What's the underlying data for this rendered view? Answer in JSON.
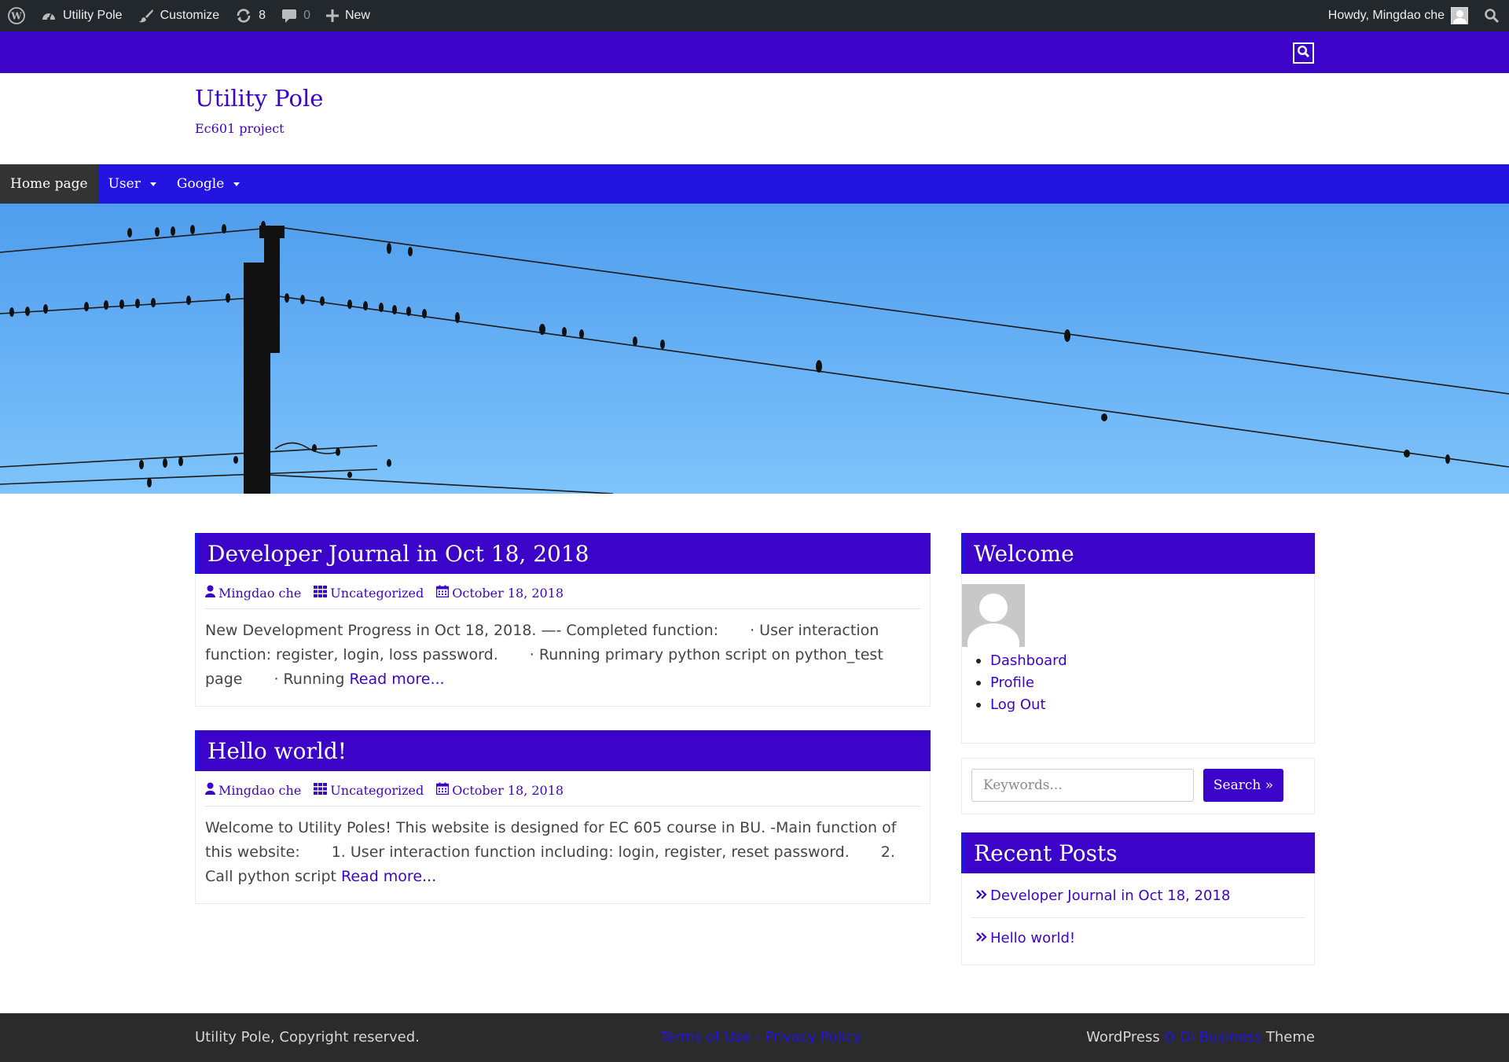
{
  "adminbar": {
    "wp_logo": "wordpress-logo-icon",
    "site_name": "Utility Pole",
    "customize": "Customize",
    "updates_count": "8",
    "comments_count": "0",
    "new_label": "New",
    "howdy": "Howdy, Mingdao che"
  },
  "header": {
    "title": "Utility Pole",
    "description": "Ec601 project"
  },
  "nav": {
    "items": [
      {
        "label": "Home page"
      },
      {
        "label": "User"
      },
      {
        "label": "Google"
      }
    ]
  },
  "posts": [
    {
      "title": "Developer Journal in Oct 18, 2018",
      "author": "Mingdao che",
      "category": "Uncategorized",
      "date": "October 18, 2018",
      "excerpt_l1a": "New Development Progress in Oct 18, 2018. —- Completed function:",
      "excerpt_l1b": "· User interaction",
      "excerpt_l2a": "function: register, login, loss password.",
      "excerpt_l2b": "· Running primary python script on python_test",
      "excerpt_l3a": "page",
      "excerpt_l3b": "· Running",
      "read_more": "Read more..."
    },
    {
      "title": "Hello world!",
      "author": "Mingdao che",
      "category": "Uncategorized",
      "date": "October 18, 2018",
      "excerpt_l1": "Welcome to Utility Poles! This website is designed for EC 605 course in BU. -Main function of",
      "excerpt_l2a": "this website:",
      "excerpt_l2b": "1. User interaction function including: login, register, reset password.",
      "excerpt_l2c": "2.",
      "excerpt_l3a": "Call python script",
      "read_more": "Read more..."
    }
  ],
  "sidebar": {
    "welcome_title": "Welcome",
    "links": [
      "Dashboard",
      "Profile",
      "Log Out"
    ],
    "search_placeholder": "Keywords...",
    "search_button": "Search »",
    "recent_title": "Recent Posts",
    "recent": [
      "Developer Journal in Oct 18, 2018",
      "Hello world!"
    ]
  },
  "footer": {
    "copyright": "Utility Pole, Copyright reserved.",
    "terms": "Terms of Use - Privacy Policy",
    "theme_prefix": "WordPress",
    "theme_link": "Di Business",
    "theme_suffix": "Theme"
  },
  "colors": {
    "brand_purple": "#3c03c9",
    "nav_blue": "#2414e1",
    "admin_bar": "#23282d",
    "footer_bg": "#2b2b2b"
  }
}
